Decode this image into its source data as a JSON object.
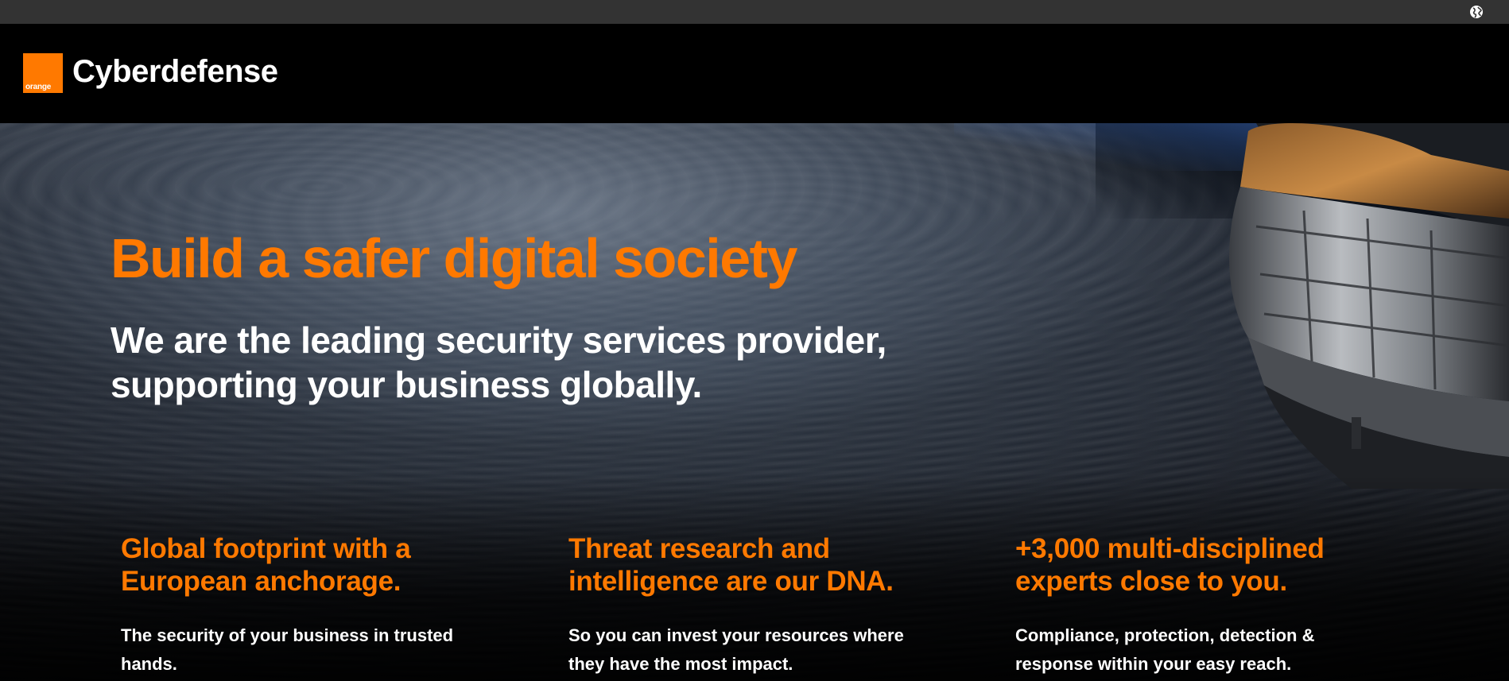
{
  "header": {
    "logo_text": "orange",
    "brand": "Cyberdefense",
    "language_icon": "globe-icon"
  },
  "hero": {
    "headline": "Build a safer digital society",
    "subline_1": "We are the leading security services provider,",
    "subline_2": "supporting your business globally."
  },
  "features": [
    {
      "title_1": "Global footprint with a",
      "title_2": "European anchorage.",
      "text_1": "The security of your business in trusted",
      "text_2": "hands."
    },
    {
      "title_1": "Threat research and",
      "title_2": "intelligence are our DNA.",
      "text_1": "So you can invest your resources where",
      "text_2": "they have the most impact."
    },
    {
      "title_1": "+3,000 multi-disciplined",
      "title_2": "experts close to you.",
      "text_1": "Compliance, protection, detection &",
      "text_2": "response within your easy reach."
    }
  ],
  "colors": {
    "accent": "#ff7900",
    "header_bg": "#000000",
    "topbar_bg": "#333333"
  }
}
